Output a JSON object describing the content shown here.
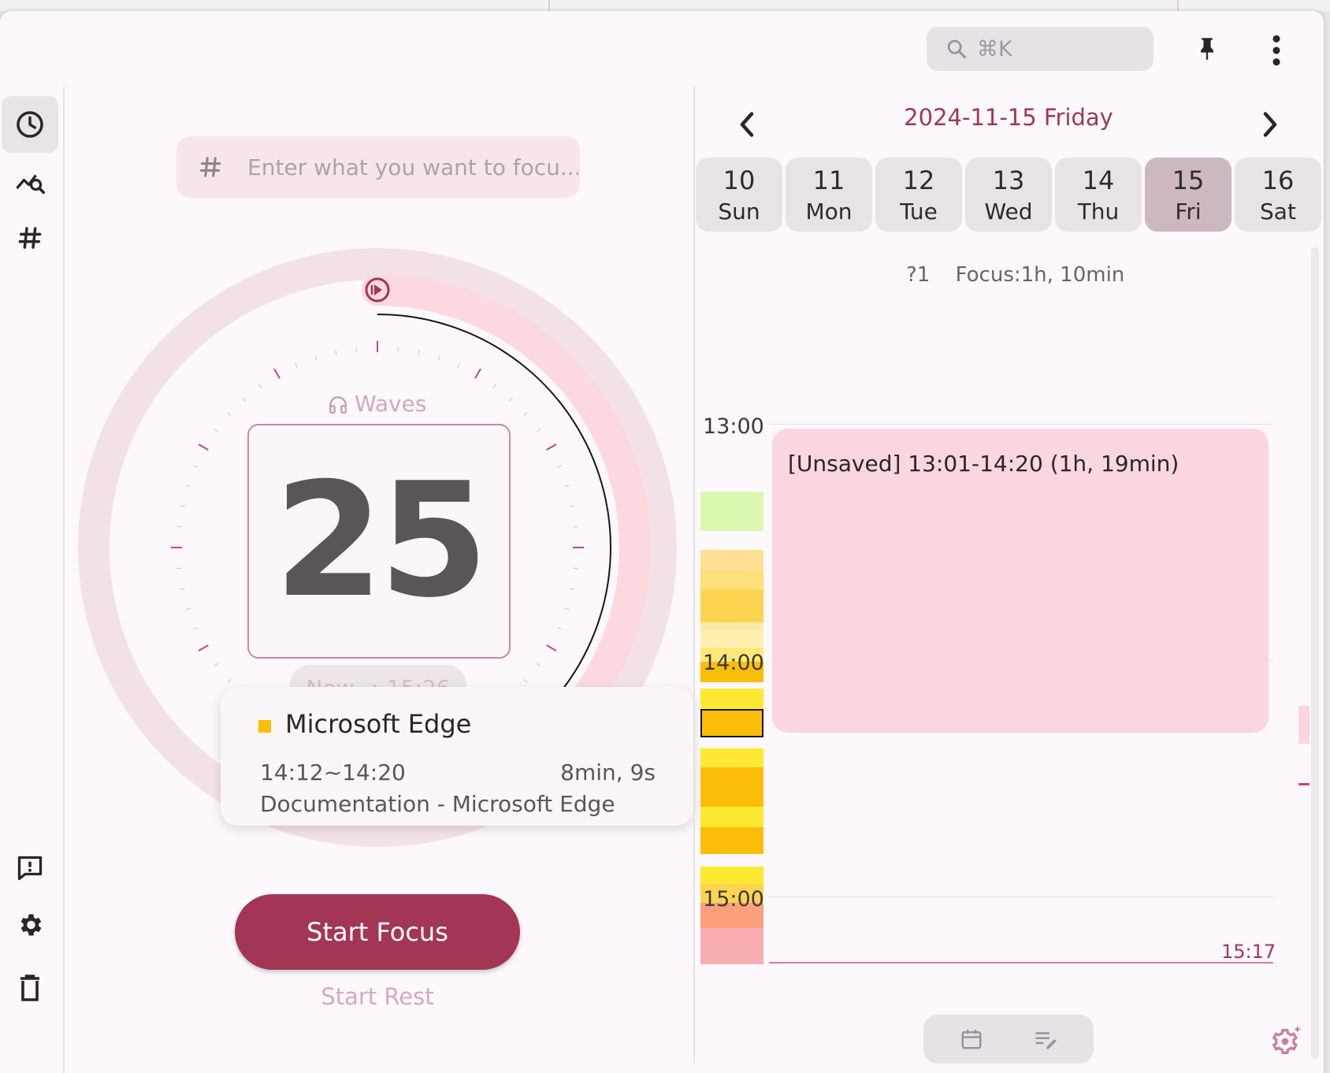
{
  "search": {
    "shortcut": "⌘K"
  },
  "focus": {
    "placeholder": "Enter what you want to focu...",
    "sound_label": "Waves",
    "timer_minutes": "25",
    "eta": "Now → 15:26",
    "start_focus": "Start Focus",
    "start_rest": "Start Rest",
    "progress_fraction": 0.42
  },
  "tooltip": {
    "app": "Microsoft Edge",
    "range": "14:12~14:20",
    "duration": "8min, 9s",
    "window_title": "Documentation - Microsoft Edge",
    "color": "#fbbd08"
  },
  "calendar": {
    "date_title": "2024-11-15 Friday",
    "days": [
      {
        "num": "10",
        "wd": "Sun"
      },
      {
        "num": "11",
        "wd": "Mon"
      },
      {
        "num": "12",
        "wd": "Tue"
      },
      {
        "num": "13",
        "wd": "Wed"
      },
      {
        "num": "14",
        "wd": "Thu"
      },
      {
        "num": "15",
        "wd": "Fri"
      },
      {
        "num": "16",
        "wd": "Sat"
      }
    ],
    "selected_index": 5,
    "summary_count": "?1",
    "summary_focus": "Focus:1h, 10min",
    "hours": [
      "13:00",
      "14:00",
      "15:00"
    ],
    "event_label": "[Unsaved] 13:01-14:20 (1h, 19min)",
    "now_time": "15:17"
  },
  "colors": {
    "accent": "#a33655",
    "event": "#fad6de",
    "selected_day": "#cdb8c2"
  }
}
